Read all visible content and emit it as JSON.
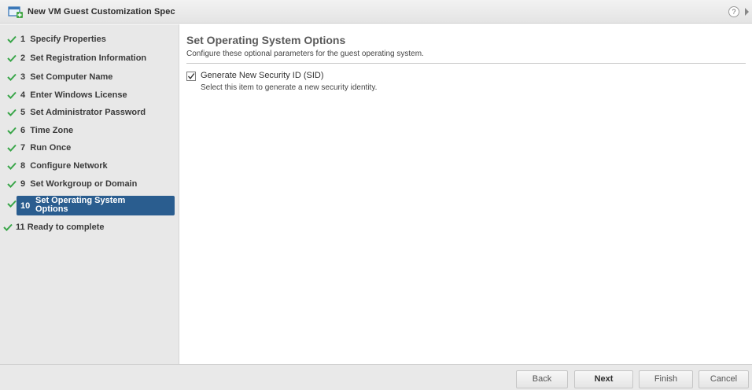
{
  "window": {
    "title": "New VM Guest Customization Spec",
    "help_icon": "help-icon",
    "help_glyph": "?"
  },
  "steps": [
    {
      "number": "1",
      "label": "Specify Properties",
      "state": "complete"
    },
    {
      "number": "2",
      "label": "Set Registration Information",
      "state": "complete"
    },
    {
      "number": "3",
      "label": "Set Computer Name",
      "state": "complete"
    },
    {
      "number": "4",
      "label": "Enter Windows License",
      "state": "complete"
    },
    {
      "number": "5",
      "label": "Set Administrator Password",
      "state": "complete"
    },
    {
      "number": "6",
      "label": "Time Zone",
      "state": "complete"
    },
    {
      "number": "7",
      "label": "Run Once",
      "state": "complete"
    },
    {
      "number": "8",
      "label": "Configure Network",
      "state": "complete"
    },
    {
      "number": "9",
      "label": "Set Workgroup or Domain",
      "state": "complete"
    },
    {
      "number": "10",
      "label": "Set Operating System Options",
      "state": "active"
    },
    {
      "number": "11",
      "label": "Ready to complete",
      "state": "complete"
    }
  ],
  "main": {
    "title": "Set Operating System Options",
    "subtitle": "Configure these optional parameters for the guest operating system.",
    "option": {
      "label": "Generate New Security ID (SID)",
      "description": "Select this item to generate a new security identity.",
      "checked": true
    }
  },
  "footer": {
    "back": "Back",
    "next": "Next",
    "finish": "Finish",
    "cancel": "Cancel"
  },
  "colors": {
    "accent": "#2a5d8f",
    "check": "#3aa64a"
  }
}
